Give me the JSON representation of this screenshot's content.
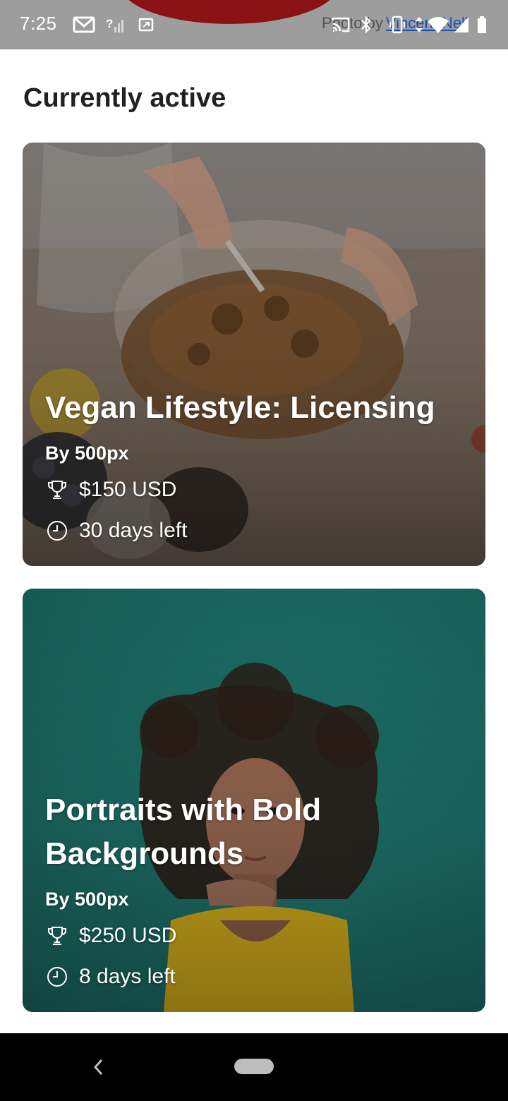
{
  "status_bar": {
    "time": "7:25",
    "icons": [
      "gmail-icon",
      "signal-unknown-icon",
      "screenshot-icon",
      "cast-icon",
      "bluetooth-icon",
      "vibrate-icon",
      "data-arrows-icon",
      "wifi-icon",
      "cell-signal-icon",
      "battery-icon"
    ],
    "photo_credit_prefix": "Photo by",
    "photo_credit_name": "Vincent Nell"
  },
  "section": {
    "title": "Currently active"
  },
  "challenges": [
    {
      "title": "Vegan Lifestyle: Licensing",
      "by": "By 500px",
      "prize": "$150 USD",
      "time_left": "30 days left",
      "prize_icon": "trophy-icon",
      "time_icon": "clock-icon"
    },
    {
      "title": "Portraits with Bold Backgrounds",
      "by": "By 500px",
      "prize": "$250 USD",
      "time_left": "8 days left",
      "prize_icon": "trophy-icon",
      "time_icon": "clock-icon"
    }
  ],
  "nav_bar": {
    "back_icon": "back-chevron-icon",
    "home_icon": "home-pill-icon"
  },
  "colors": {
    "status_bar_bg": "#9d9d9d",
    "title_text": "#212121",
    "card2_teal": "#1c6d66",
    "credit_link": "#1a4dab"
  }
}
